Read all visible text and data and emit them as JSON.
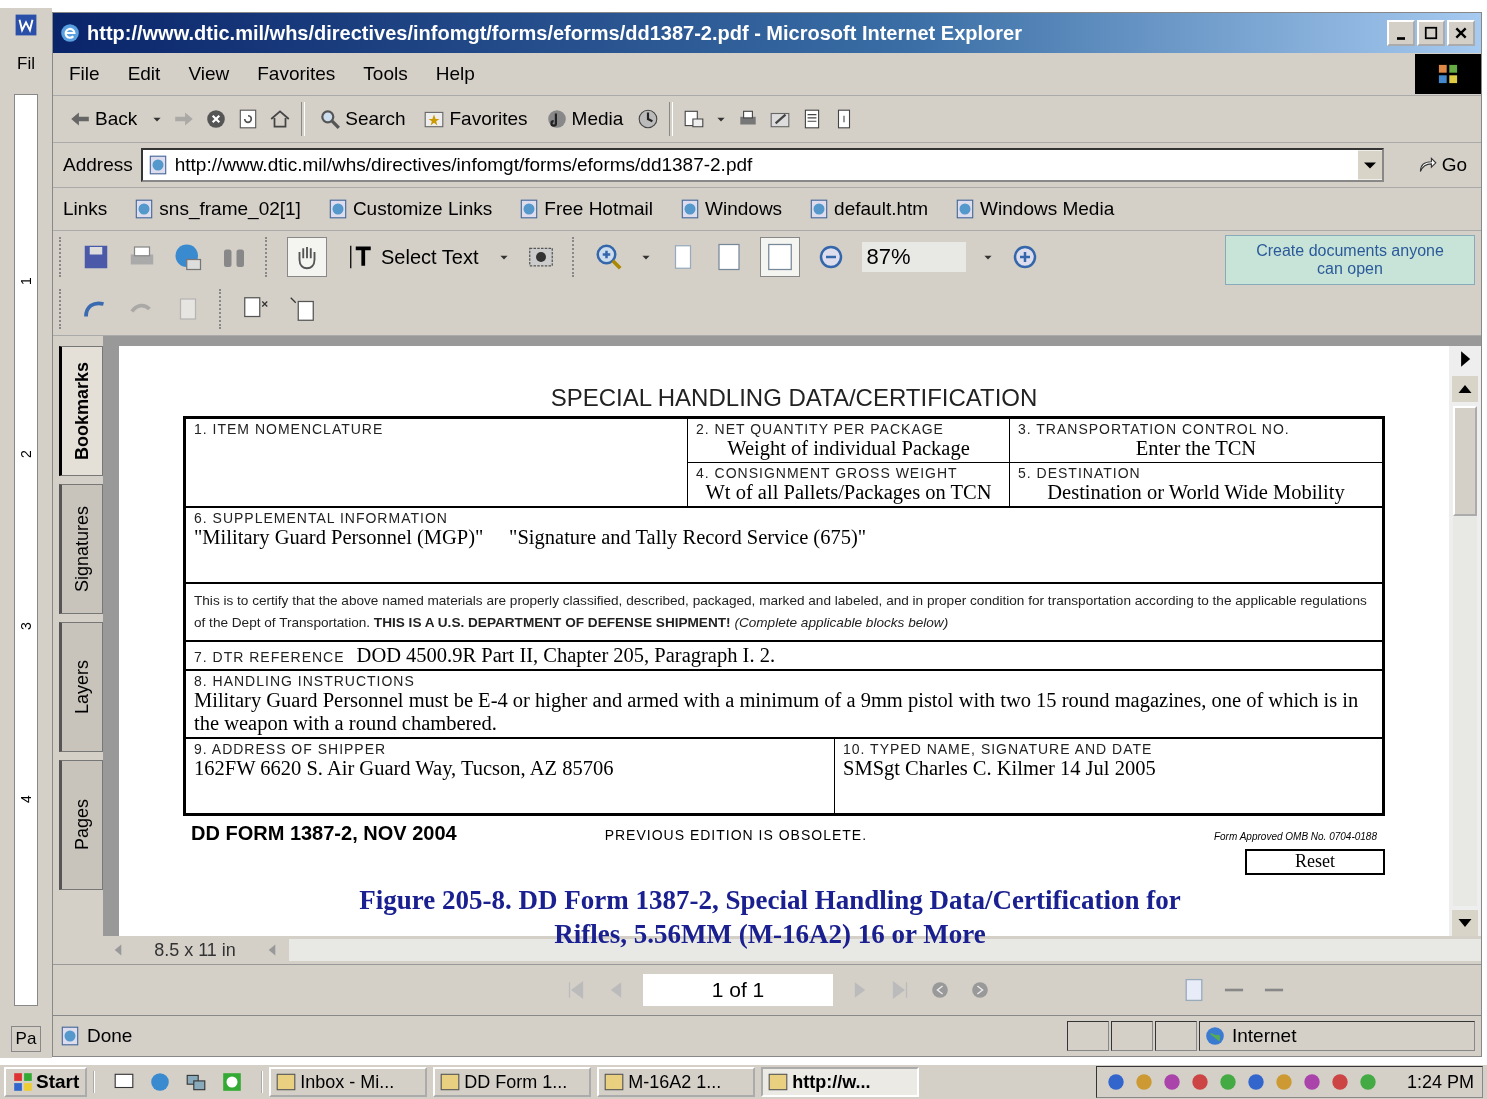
{
  "background_app": {
    "menu_fragment": "Fil",
    "status_fragment": "Pa",
    "ruler_labels": [
      "1",
      "2",
      "3",
      "4"
    ]
  },
  "window": {
    "title": "http://www.dtic.mil/whs/directives/infomgt/forms/eforms/dd1387-2.pdf - Microsoft Internet Explorer"
  },
  "menu": [
    "File",
    "Edit",
    "View",
    "Favorites",
    "Tools",
    "Help"
  ],
  "toolbar": {
    "back": "Back",
    "search": "Search",
    "favorites": "Favorites",
    "media": "Media"
  },
  "address": {
    "label": "Address",
    "value": "http://www.dtic.mil/whs/directives/infomgt/forms/eforms/dd1387-2.pdf",
    "go": "Go"
  },
  "links": {
    "label": "Links",
    "items": [
      "sns_frame_02[1]",
      "Customize Links",
      "Free Hotmail",
      "Windows",
      "default.htm",
      "Windows Media"
    ]
  },
  "pdf_toolbar": {
    "select_text": "Select Text",
    "zoom": "87%",
    "promo": "Create documents anyone can open"
  },
  "side_tabs": [
    {
      "label": "Bookmarks",
      "selected": true
    },
    {
      "label": "Signatures",
      "selected": false
    },
    {
      "label": "Layers",
      "selected": false
    },
    {
      "label": "Pages",
      "selected": false
    }
  ],
  "form": {
    "title": "SPECIAL HANDLING DATA/CERTIFICATION",
    "blocks": [
      {
        "label": "1.  ITEM NOMENCLATURE"
      },
      {
        "label": "2.  NET QUANTITY PER PACKAGE",
        "value": "Weight of individual Package"
      },
      {
        "label": "3.  TRANSPORTATION CONTROL NO.",
        "value": "Enter the TCN"
      },
      {
        "label": "4.  CONSIGNMENT GROSS WEIGHT",
        "value": "Wt of all Pallets/Packages on TCN"
      },
      {
        "label": "5.  DESTINATION",
        "value": "Destination or World Wide Mobility"
      },
      {
        "label": "6.  SUPPLEMENTAL INFORMATION",
        "value": "\"Military Guard Personnel (MGP)\"     \"Signature and Tally Record Service (675)\""
      },
      {
        "label": "7.  DTR REFERENCE",
        "value": "DOD 4500.9R Part II, Chapter 205, Paragraph I. 2."
      },
      {
        "label": "8.  HANDLING INSTRUCTIONS",
        "value": "Military Guard Personnel must be E-4 or higher and armed with a minimum of a 9mm pistol with two 15 round magazines, one of which is in the weapon with a round chambered."
      },
      {
        "label": "9.  ADDRESS OF SHIPPER",
        "value": "162FW 6620 S. Air Guard Way, Tucson, AZ 85706"
      },
      {
        "label": "10. TYPED NAME, SIGNATURE AND DATE",
        "value": "SMSgt Charles C. Kilmer  14 Jul 2005"
      }
    ],
    "certification": "This is to certify that the above named materials are properly classified, described, packaged, marked and labeled, and in proper condition for transportation according to the applicable regulations of the Dept of Transportation.  **THIS IS A U.S. DEPARTMENT OF DEFENSE SHIPMENT!** *(Complete applicable blocks below)*",
    "form_number": "DD FORM 1387-2, NOV 2004",
    "edition": "PREVIOUS EDITION IS OBSOLETE.",
    "omb": "Form Approved OMB No. 0704-0188",
    "reset": "Reset"
  },
  "page_size": "8.5 x 11 in",
  "page_nav": "1 of 1",
  "caption": [
    "Figure 205-8.  DD Form 1387-2, Special Handling Data/Certification for",
    "Rifles, 5.56MM (M-16A2) 16 or More"
  ],
  "status_bar": {
    "text": "Done",
    "zone": "Internet"
  },
  "taskbar": {
    "start": "Start",
    "tasks": [
      {
        "label": "Inbox - Mi...",
        "selected": false
      },
      {
        "label": "DD Form 1...",
        "selected": false
      },
      {
        "label": "M-16A2 1...",
        "selected": false
      },
      {
        "label": "http://w...",
        "selected": true
      }
    ],
    "clock": "1:24 PM"
  }
}
